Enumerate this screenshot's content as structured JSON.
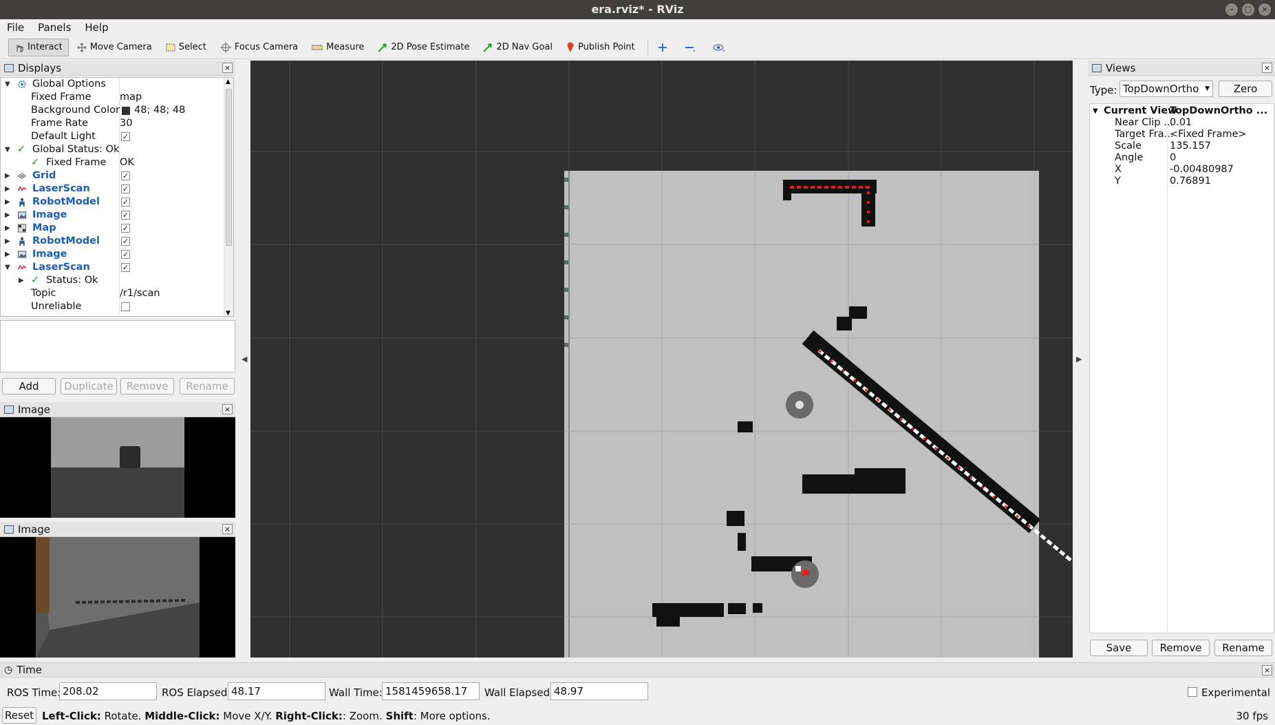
{
  "window": {
    "title": "era.rviz* - RViz"
  },
  "menu": [
    "File",
    "Panels",
    "Help"
  ],
  "toolbar": {
    "interact": "Interact",
    "move_camera": "Move Camera",
    "select": "Select",
    "focus_camera": "Focus Camera",
    "measure": "Measure",
    "pose_estimate": "2D Pose Estimate",
    "nav_goal": "2D Nav Goal",
    "publish_point": "Publish Point"
  },
  "displays": {
    "title": "Displays",
    "rows": [
      {
        "label": "Global Options",
        "value": ""
      },
      {
        "label": "Fixed Frame",
        "value": "map"
      },
      {
        "label": "Background Color",
        "value": "48; 48; 48"
      },
      {
        "label": "Frame Rate",
        "value": "30"
      },
      {
        "label": "Default Light",
        "value": ""
      },
      {
        "label": "Global Status: Ok",
        "value": ""
      },
      {
        "label": "Fixed Frame",
        "value": "OK"
      },
      {
        "label": "Grid",
        "value": ""
      },
      {
        "label": "LaserScan",
        "value": ""
      },
      {
        "label": "RobotModel",
        "value": ""
      },
      {
        "label": "Image",
        "value": ""
      },
      {
        "label": "Map",
        "value": ""
      },
      {
        "label": "RobotModel",
        "value": ""
      },
      {
        "label": "Image",
        "value": ""
      },
      {
        "label": "LaserScan",
        "value": ""
      },
      {
        "label": "Status: Ok",
        "value": ""
      },
      {
        "label": "Topic",
        "value": "/r1/scan"
      },
      {
        "label": "Unreliable",
        "value": ""
      }
    ],
    "buttons": {
      "add": "Add",
      "duplicate": "Duplicate",
      "remove": "Remove",
      "rename": "Rename"
    }
  },
  "image_panels": [
    {
      "title": "Image"
    },
    {
      "title": "Image"
    }
  ],
  "views": {
    "title": "Views",
    "type_label": "Type:",
    "type_value": "TopDownOrtho",
    "zero": "Zero",
    "current_view": "Current View",
    "current_view_value": "TopDownOrtho ...",
    "props": [
      {
        "label": "Near Clip ...",
        "value": "0.01"
      },
      {
        "label": "Target Fra...",
        "value": "<Fixed Frame>"
      },
      {
        "label": "Scale",
        "value": "135.157"
      },
      {
        "label": "Angle",
        "value": "0"
      },
      {
        "label": "X",
        "value": "-0.00480987"
      },
      {
        "label": "Y",
        "value": "0.76891"
      }
    ],
    "buttons": {
      "save": "Save",
      "remove": "Remove",
      "rename": "Rename"
    }
  },
  "time": {
    "title": "Time",
    "ros_time_label": "ROS Time:",
    "ros_time": "208.02",
    "ros_elapsed_label": "ROS Elapsed:",
    "ros_elapsed": "48.17",
    "wall_time_label": "Wall Time:",
    "wall_time": "1581459658.17",
    "wall_elapsed_label": "Wall Elapsed:",
    "wall_elapsed": "48.97",
    "experimental": "Experimental"
  },
  "status": {
    "reset": "Reset",
    "hint_b1": "Left-Click:",
    "hint_t1": " Rotate. ",
    "hint_b2": "Middle-Click:",
    "hint_t2": " Move X/Y. ",
    "hint_b3": "Right-Click:",
    "hint_t3": ": Zoom. ",
    "hint_b4": "Shift",
    "hint_t4": ": More options.",
    "fps": "30 fps"
  },
  "colors": {
    "background": "#303030",
    "map_free": "#c0c0c0",
    "laser": "#e02020"
  }
}
